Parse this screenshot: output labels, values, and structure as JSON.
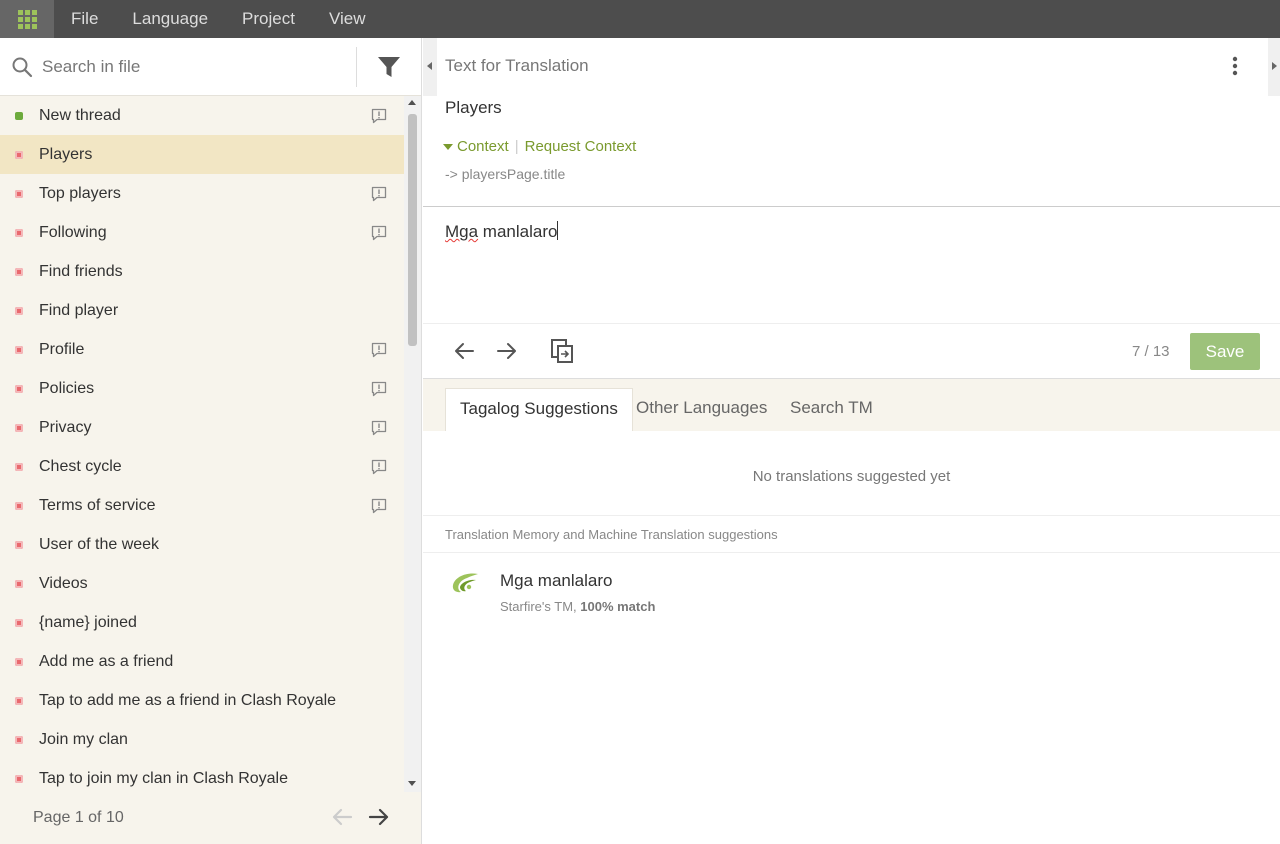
{
  "menu": {
    "items": [
      "File",
      "Language",
      "Project",
      "View"
    ]
  },
  "sidebar": {
    "search_placeholder": "Search in file",
    "items": [
      {
        "label": "New thread",
        "status": "translated",
        "comment": true
      },
      {
        "label": "Players",
        "status": "untranslated",
        "comment": false,
        "selected": true
      },
      {
        "label": "Top players",
        "status": "untranslated",
        "comment": true
      },
      {
        "label": "Following",
        "status": "untranslated",
        "comment": true
      },
      {
        "label": "Find friends",
        "status": "untranslated",
        "comment": false
      },
      {
        "label": "Find player",
        "status": "untranslated",
        "comment": false
      },
      {
        "label": "Profile",
        "status": "untranslated",
        "comment": true
      },
      {
        "label": "Policies",
        "status": "untranslated",
        "comment": true
      },
      {
        "label": "Privacy",
        "status": "untranslated",
        "comment": true
      },
      {
        "label": "Chest cycle",
        "status": "untranslated",
        "comment": true
      },
      {
        "label": "Terms of service",
        "status": "untranslated",
        "comment": true
      },
      {
        "label": "User of the week",
        "status": "untranslated",
        "comment": false
      },
      {
        "label": "Videos",
        "status": "untranslated",
        "comment": false
      },
      {
        "label": "{name} joined",
        "status": "untranslated",
        "comment": false
      },
      {
        "label": "Add me as a friend",
        "status": "untranslated",
        "comment": false
      },
      {
        "label": "Tap to add me as a friend in Clash Royale",
        "status": "untranslated",
        "comment": false
      },
      {
        "label": "Join my clan",
        "status": "untranslated",
        "comment": false
      },
      {
        "label": "Tap to join my clan in Clash Royale",
        "status": "untranslated",
        "comment": false
      }
    ],
    "page_label": "Page 1 of 10"
  },
  "editor": {
    "section_title": "Text for Translation",
    "source_text": "Players",
    "context_label": "Context",
    "request_context_label": "Request Context",
    "context_key": "-> playersPage.title",
    "translation_word1": "Mga",
    "translation_rest": " manlalaro",
    "counter": "7 / 13",
    "save_label": "Save"
  },
  "suggestions": {
    "tabs": [
      "Tagalog Suggestions",
      "Other Languages",
      "Search TM"
    ],
    "empty_message": "No translations suggested yet",
    "tm_heading": "Translation Memory and Machine Translation suggestions",
    "tm_text": "Mga manlalaro",
    "tm_source": "Starfire's TM, ",
    "tm_match": "100% match"
  },
  "colors": {
    "accent": "#9dc35b",
    "link": "#7a9a2e",
    "save": "#9dc27b",
    "selected_row": "#f2e6c4"
  }
}
